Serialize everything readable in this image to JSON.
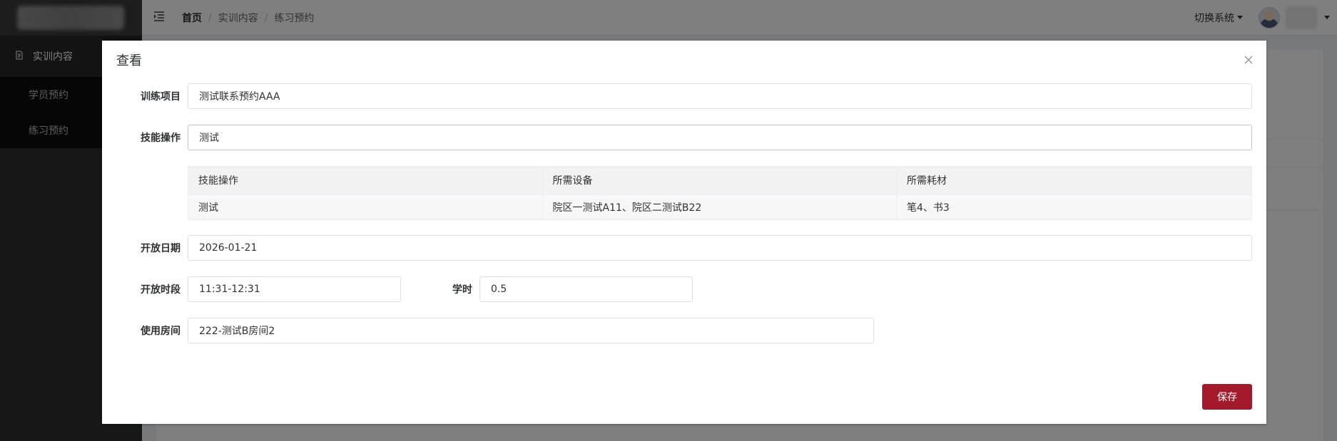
{
  "sidebar": {
    "menu_group": "实训内容",
    "items": [
      {
        "label": "学员预约"
      },
      {
        "label": "练习预约"
      }
    ]
  },
  "header": {
    "breadcrumb": [
      "首页",
      "实训内容",
      "练习预约"
    ],
    "switch_system": "切换系统"
  },
  "dialog": {
    "title": "查看",
    "fields": {
      "training_project": {
        "label": "训练项目",
        "value": "测试联系预约AAA"
      },
      "skill_operation": {
        "label": "技能操作",
        "value": "测试"
      },
      "open_date": {
        "label": "开放日期",
        "value": "2026-01-21"
      },
      "open_period": {
        "label": "开放时段",
        "value": "11:31-12:31"
      },
      "class_hours": {
        "label": "学时",
        "value": "0.5"
      },
      "room": {
        "label": "使用房间",
        "value": "222-测试B房间2"
      }
    },
    "table": {
      "columns": [
        "技能操作",
        "所需设备",
        "所需耗材"
      ],
      "rows": [
        [
          "测试",
          "院区一测试A11、院区二测试B22",
          "笔4、书3"
        ]
      ]
    },
    "save_label": "保存"
  },
  "colors": {
    "primary_button": "#a31a2c",
    "sidebar_bg": "#2f2f2f",
    "overlay": "rgba(0,0,0,0.5)"
  }
}
